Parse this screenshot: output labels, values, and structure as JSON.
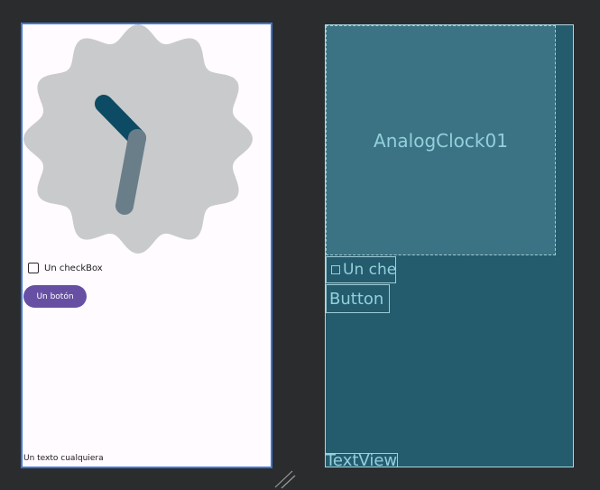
{
  "design": {
    "checkbox_label": "Un checkBox",
    "button_label": "Un botón",
    "textview_text": "Un texto cualquiera"
  },
  "blueprint": {
    "clock_label": "AnalogClock01",
    "checkbox_label": "Un checkBox",
    "button_label": "Button",
    "textview_label": "TextView"
  },
  "colors": {
    "canvas": "#2b2c2e",
    "design_bg": "#fffbfe",
    "clock_face": "#c9cacc",
    "hour_hand": "#0c4b63",
    "minute_hand": "#6a7e89",
    "button": "#6750a4",
    "blueprint_bg": "#245b6d",
    "blueprint_widget": "#3b7384",
    "blueprint_text": "#93d0dc"
  }
}
